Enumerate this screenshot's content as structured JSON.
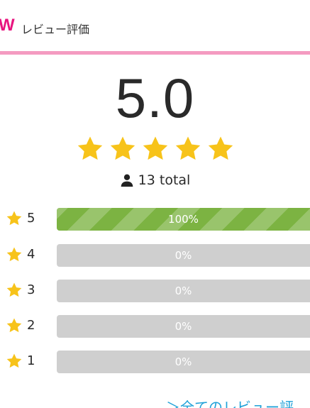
{
  "header": {
    "mark": "W",
    "title": "レビュー評価"
  },
  "summary": {
    "score": "5.0",
    "star_rating": 5,
    "total": "13 total"
  },
  "rating_rows": [
    {
      "stars": "5",
      "percent_text": "100%",
      "percent": 100
    },
    {
      "stars": "4",
      "percent_text": "0%",
      "percent": 0
    },
    {
      "stars": "3",
      "percent_text": "0%",
      "percent": 0
    },
    {
      "stars": "2",
      "percent_text": "0%",
      "percent": 0
    },
    {
      "stars": "1",
      "percent_text": "0%",
      "percent": 0
    }
  ],
  "footer": {
    "all_reviews_link": "＞全てのレビュー評"
  },
  "colors": {
    "accent": "#e8157f",
    "divider": "#f49bc1",
    "star": "#f7c31a",
    "bar_fill": "#7cb342",
    "bar_empty": "#cfcfcf",
    "link": "#1ea1d8"
  },
  "icons": {
    "star": "star-icon",
    "user": "user-icon"
  }
}
